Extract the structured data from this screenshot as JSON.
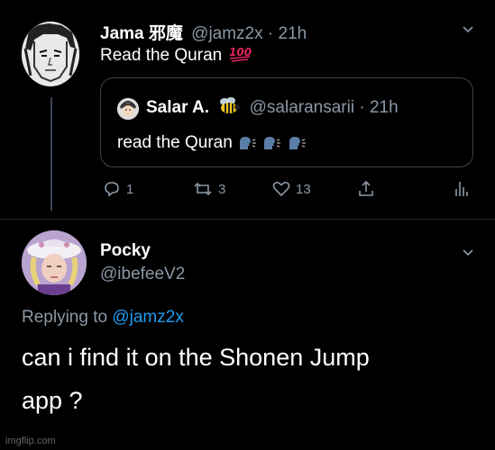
{
  "tweet": {
    "author_name": "Jama 邪魔",
    "handle_time": "@jamz2x · 21h",
    "text": "Read the Quran",
    "emoji": "💯",
    "quoted": {
      "author_name": "Salar A.",
      "handle_time": "@salaransarii · 21h",
      "text": "read the Quran"
    },
    "actions": {
      "replies": "1",
      "retweets": "3",
      "likes": "13"
    }
  },
  "reply": {
    "author_name": "Pocky",
    "handle": "@ibefeeV2",
    "replying_prefix": "Replying to ",
    "replying_to": "@jamz2x",
    "text_line1": "can i find it on the Shonen Jump",
    "text_line2": "app ?"
  },
  "watermark": "imgflip.com",
  "colors": {
    "background": "#000000",
    "secondary_text": "#8b98a5",
    "link": "#1d9bf0",
    "border": "#3b4652"
  }
}
